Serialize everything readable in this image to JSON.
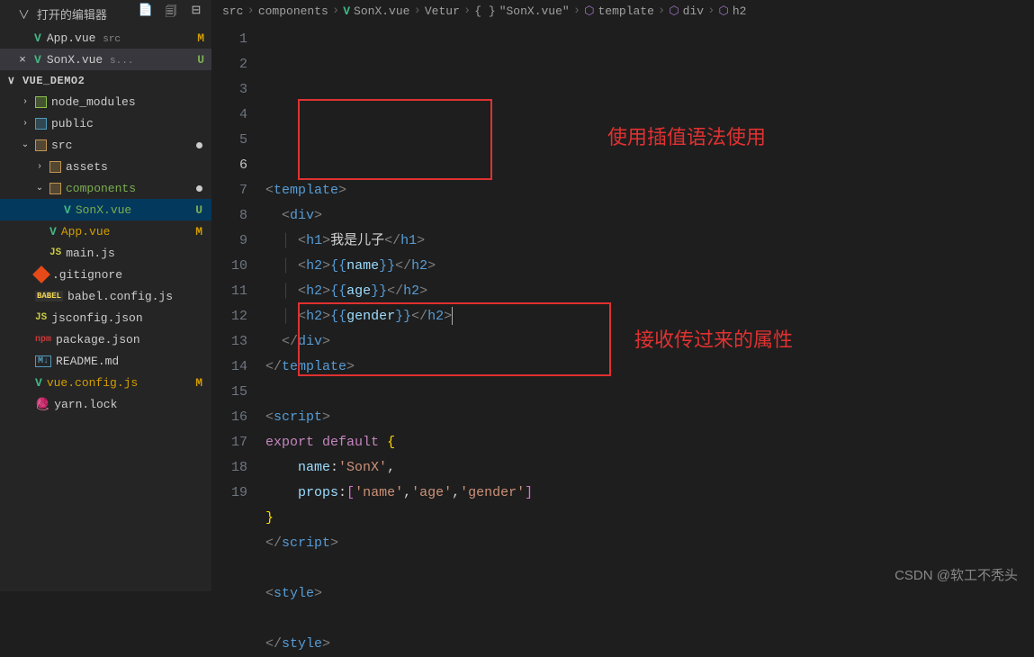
{
  "sidebar": {
    "open_editors_label": "打开的编辑器",
    "editors": [
      {
        "name": "App.vue",
        "path": "src",
        "status": "M",
        "active": false
      },
      {
        "name": "SonX.vue",
        "path": "s...",
        "status": "U",
        "active": true
      }
    ],
    "project_name": "VUE_DEMO2",
    "tree": [
      {
        "indent": 1,
        "chevron": ">",
        "icon": "folder-node",
        "label": "node_modules",
        "color": ""
      },
      {
        "indent": 1,
        "chevron": ">",
        "icon": "folder-public",
        "label": "public",
        "color": ""
      },
      {
        "indent": 1,
        "chevron": "v",
        "icon": "folder-src",
        "label": "src",
        "color": "",
        "modified": true
      },
      {
        "indent": 2,
        "chevron": ">",
        "icon": "folder-assets",
        "label": "assets",
        "color": ""
      },
      {
        "indent": 2,
        "chevron": "v",
        "icon": "folder-comp",
        "label": "components",
        "color": "green",
        "modified": true
      },
      {
        "indent": 3,
        "chevron": "",
        "icon": "vue",
        "label": "SonX.vue",
        "color": "green",
        "status": "U",
        "selected": true
      },
      {
        "indent": 2,
        "chevron": "",
        "icon": "vue",
        "label": "App.vue",
        "color": "yellow",
        "status": "M"
      },
      {
        "indent": 2,
        "chevron": "",
        "icon": "js",
        "label": "main.js",
        "color": ""
      },
      {
        "indent": 1,
        "chevron": "",
        "icon": "git",
        "label": ".gitignore",
        "color": ""
      },
      {
        "indent": 1,
        "chevron": "",
        "icon": "babel",
        "label": "babel.config.js",
        "color": ""
      },
      {
        "indent": 1,
        "chevron": "",
        "icon": "jsconf",
        "label": "jsconfig.json",
        "color": ""
      },
      {
        "indent": 1,
        "chevron": "",
        "icon": "npm",
        "label": "package.json",
        "color": ""
      },
      {
        "indent": 1,
        "chevron": "",
        "icon": "md",
        "label": "README.md",
        "color": ""
      },
      {
        "indent": 1,
        "chevron": "",
        "icon": "vueconf",
        "label": "vue.config.js",
        "color": "yellow",
        "status": "M"
      },
      {
        "indent": 1,
        "chevron": "",
        "icon": "yarn",
        "label": "yarn.lock",
        "color": ""
      }
    ]
  },
  "breadcrumb": {
    "items": [
      {
        "label": "src",
        "icon": ""
      },
      {
        "label": "components",
        "icon": ""
      },
      {
        "label": "SonX.vue",
        "icon": "vue"
      },
      {
        "label": "Vetur",
        "icon": ""
      },
      {
        "label": "\"SonX.vue\"",
        "icon": "brace"
      },
      {
        "label": "template",
        "icon": "cube"
      },
      {
        "label": "div",
        "icon": "cube"
      },
      {
        "label": "h2",
        "icon": "cube"
      }
    ]
  },
  "code": {
    "active_line": 6,
    "lines": [
      "<template>",
      "  <div>",
      "    <h1>我是儿子</h1>",
      "    <h2>{{name}}</h2>",
      "    <h2>{{age}}</h2>",
      "    <h2>{{gender}}</h2>",
      "  </div>",
      "</template>",
      "",
      "<script>",
      "export default {",
      "    name:'SonX',",
      "    props:['name','age','gender']",
      "}",
      "</script>",
      "",
      "<style>",
      "",
      "</style>"
    ]
  },
  "annotations": {
    "a1": "使用插值语法使用",
    "a2": "接收传过来的属性"
  },
  "watermark": "CSDN @软工不秃头"
}
